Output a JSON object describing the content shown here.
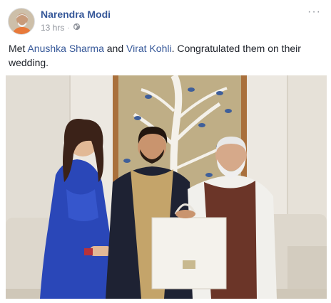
{
  "post": {
    "author": "Narendra Modi",
    "time": "13 hrs",
    "separator": "·",
    "text_before": "Met ",
    "mention1": "Anushka Sharma",
    "text_middle": " and ",
    "mention2": "Virat Kohli",
    "text_after": ". Congratulated them on their wedding.",
    "more": "···"
  },
  "colors": {
    "link": "#365899",
    "meta": "#90949c",
    "text": "#1d2129"
  },
  "icons": [
    "globe-icon",
    "more-options-icon"
  ]
}
